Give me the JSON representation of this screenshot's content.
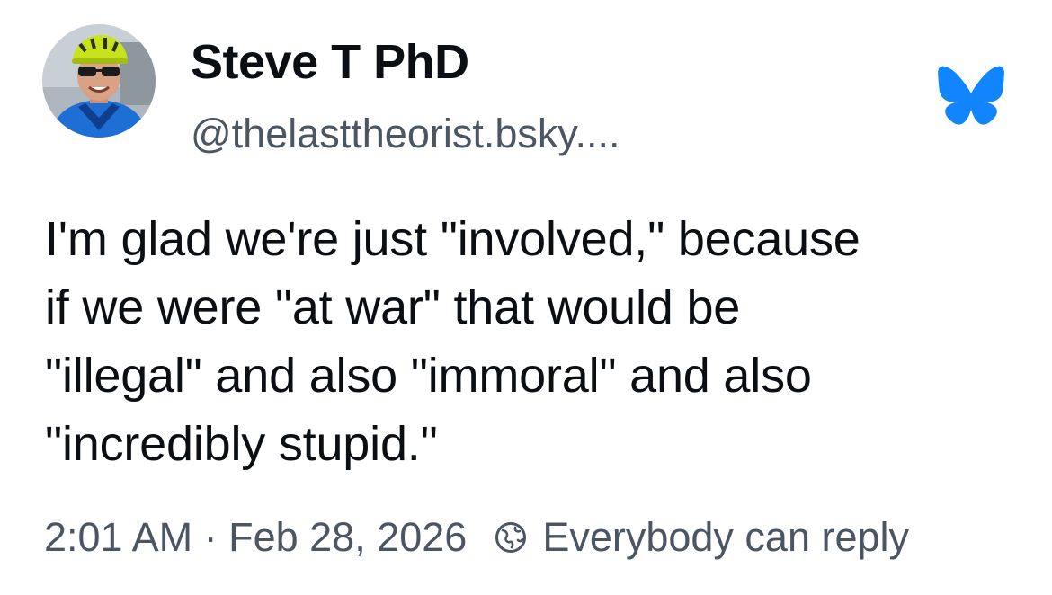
{
  "author": {
    "display_name": "Steve T PhD",
    "handle": "@thelasttheorist.bsky....",
    "avatar_icon": "profile-photo-cyclist"
  },
  "brand": {
    "logo_icon": "bluesky-butterfly-icon",
    "logo_color": "#1185fe"
  },
  "post": {
    "text": "I'm glad we're just \"involved,\" because\nif we were \"at war\" that would be\n\"illegal\" and also \"immoral\" and also\n\"incredibly stupid.\""
  },
  "footer": {
    "timestamp": "2:01 AM · Feb 28, 2026",
    "reply_setting": "Everybody can reply",
    "reply_icon": "globe-icon"
  },
  "colors": {
    "text_primary": "#0b0f14",
    "text_secondary": "#4b5563",
    "background": "#ffffff"
  }
}
